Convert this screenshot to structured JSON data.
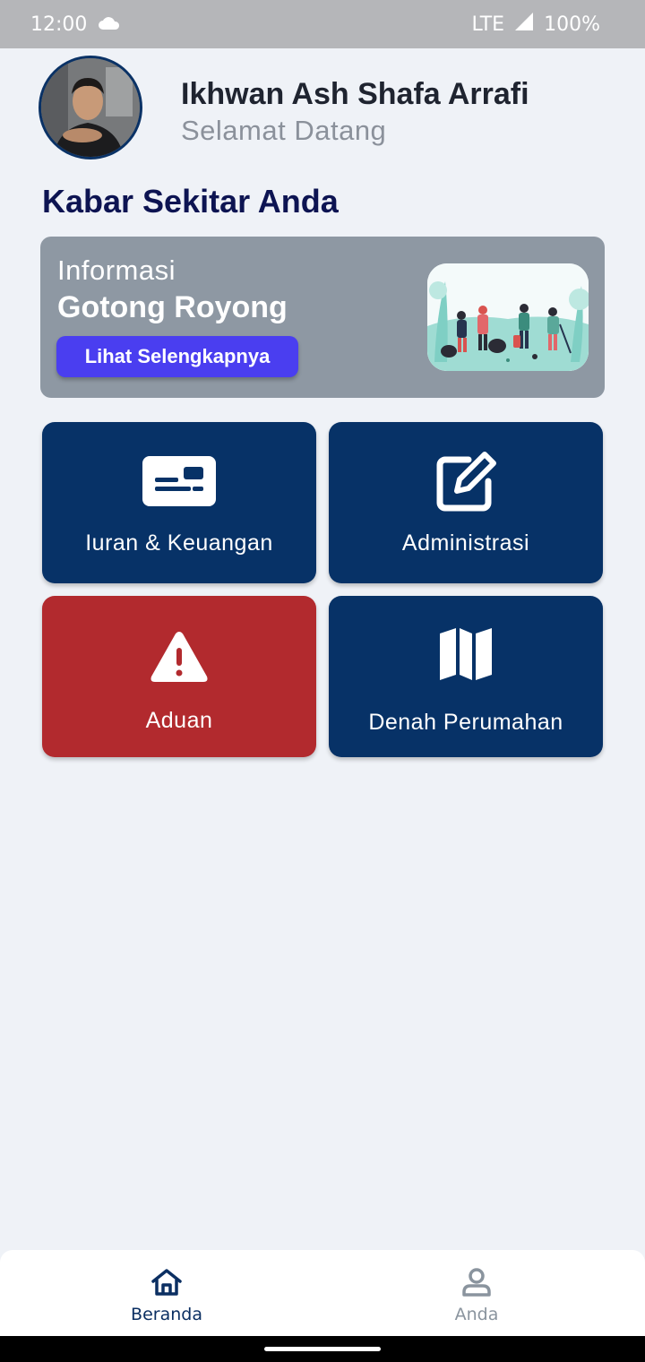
{
  "status_bar": {
    "time": "12:00",
    "network": "LTE",
    "battery": "100%",
    "icons": [
      "cloud-icon",
      "signal-icon"
    ]
  },
  "header": {
    "user_name": "Ikhwan Ash Shafa Arrafi",
    "greeting": "Selamat Datang"
  },
  "section_title": "Kabar Sekitar Anda",
  "info_card": {
    "label": "Informasi",
    "title": "Gotong Royong",
    "button_label": "Lihat Selengkapnya"
  },
  "menu": {
    "iuran": {
      "label": "Iuran & Keuangan",
      "icon": "id-card-icon",
      "color": "#073267"
    },
    "administrasi": {
      "label": "Administrasi",
      "icon": "edit-icon",
      "color": "#073267"
    },
    "aduan": {
      "label": "Aduan",
      "icon": "warning-icon",
      "color": "#b22a2e"
    },
    "denah": {
      "label": "Denah Perumahan",
      "icon": "map-icon",
      "color": "#073267"
    }
  },
  "bottom_nav": {
    "home_label": "Beranda",
    "profile_label": "Anda"
  },
  "colors": {
    "background": "#eff2f7",
    "primary": "#073267",
    "danger": "#b22a2e",
    "accent": "#4a3ef0",
    "card_grey": "#8e98a3"
  }
}
